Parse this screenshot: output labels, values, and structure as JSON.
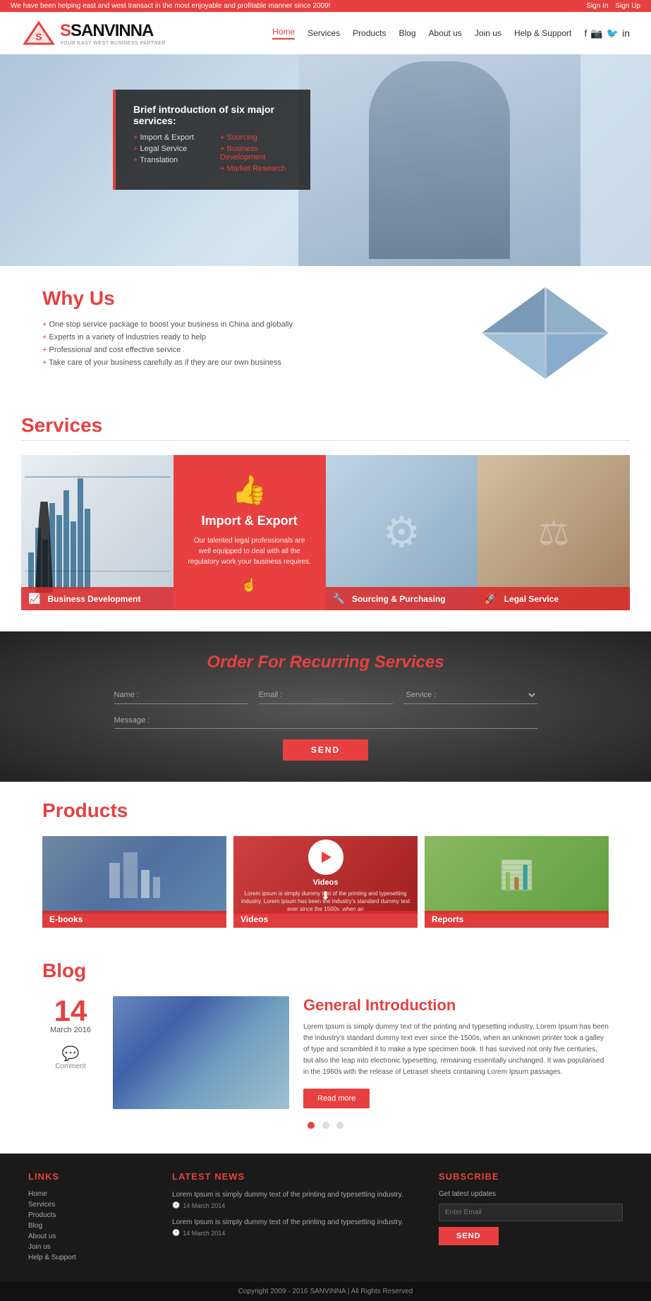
{
  "topbar": {
    "message": "We have been helping east and west transact in the most enjoyable and profitable manner since 2009!",
    "signin": "Sign In",
    "signup": "Sign Up"
  },
  "header": {
    "logo_name": "SANVINNA",
    "logo_tagline": "YOUR EAST WEST BUSINESS PARTNER",
    "nav": {
      "items": [
        {
          "label": "Home",
          "active": true
        },
        {
          "label": "Services"
        },
        {
          "label": "Products"
        },
        {
          "label": "Blog"
        },
        {
          "label": "About us"
        },
        {
          "label": "Join us"
        },
        {
          "label": "Help & Support"
        }
      ]
    }
  },
  "hero": {
    "title": "Brief introduction of six major services:",
    "services_col1": [
      "Import & Export",
      "Legal Service",
      "Translation"
    ],
    "services_col2": [
      "Sourcing",
      "Business Development",
      "Market Research"
    ]
  },
  "why_us": {
    "title": "Why Us",
    "points": [
      "One stop service package to boost your business in China and globally",
      "Experts in a variety of industries ready to help",
      "Professional and cost effective service",
      "Take care of your business carefully as if they are our own business"
    ]
  },
  "services": {
    "title": "Services",
    "cards": [
      {
        "id": "biz-dev",
        "label": "Business Development",
        "icon": "📈"
      },
      {
        "id": "import-export",
        "label": "Import & Export",
        "icon": "👍",
        "description": "Our talented legal professionals are well equipped to deal with all the regulatory work your business requires."
      },
      {
        "id": "sourcing",
        "label": "Sourcing & Purchasing",
        "icon": "🔧"
      },
      {
        "id": "legal",
        "label": "Legal Service",
        "icon": "🚀"
      }
    ]
  },
  "order": {
    "title": "Order For Recurring Services",
    "name_placeholder": "Name :",
    "email_placeholder": "Email :",
    "service_placeholder": "Service :",
    "message_placeholder": "Message :",
    "send_label": "SEND"
  },
  "products": {
    "title": "Products",
    "cards": [
      {
        "id": "ebooks",
        "label": "E-books"
      },
      {
        "id": "videos",
        "label": "Videos",
        "title": "Videos",
        "description": "Lorem ipsum is simply dummy text of the printing and typesetting industry. Lorem ipsum has been the industry's standard dummy text ever since the 1500s, when an"
      },
      {
        "id": "reports",
        "label": "Reports"
      }
    ]
  },
  "blog": {
    "title": "Blog",
    "post": {
      "day": "14",
      "month_year": "March 2016",
      "comment_label": "Comment",
      "post_title": "General Introduction",
      "body": "Lorem Ipsum is simply dummy text of the printing and typesetting industry. Lorem Ipsum has been the industry's standard dummy text ever since the 1500s, when an unknown printer took a galley of type and scrambled it to make a type specimen book. It has survived not only five centuries, but also the leap into electronic typesetting, remaining essentially unchanged. It was popularised in the 1960s with the release of Letraset sheets containing Lorem Ipsum passages.",
      "read_more": "Read more"
    },
    "dots": [
      1,
      2,
      3
    ]
  },
  "footer": {
    "links_title": "LINKS",
    "links": [
      "Home",
      "Services",
      "Products",
      "Blog",
      "About us",
      "Join us",
      "Help & Support"
    ],
    "news_title": "LATEST NEWS",
    "news": [
      {
        "text": "Lorem Ipsum is simply dummy text of the printing and typesetting industry.",
        "date": "14 March 2014"
      },
      {
        "text": "Lorem Ipsum is simply dummy text of the printing and typesetting industry.",
        "date": "14 March 2014"
      }
    ],
    "subscribe_title": "SUBSCRIBE",
    "subscribe_text": "Get latest updates",
    "email_placeholder": "Enter Email",
    "send_label": "SEND"
  },
  "bottom": {
    "copyright": "Copyright 2009 - 2016 SANVINNA | All Rights Reserved"
  }
}
